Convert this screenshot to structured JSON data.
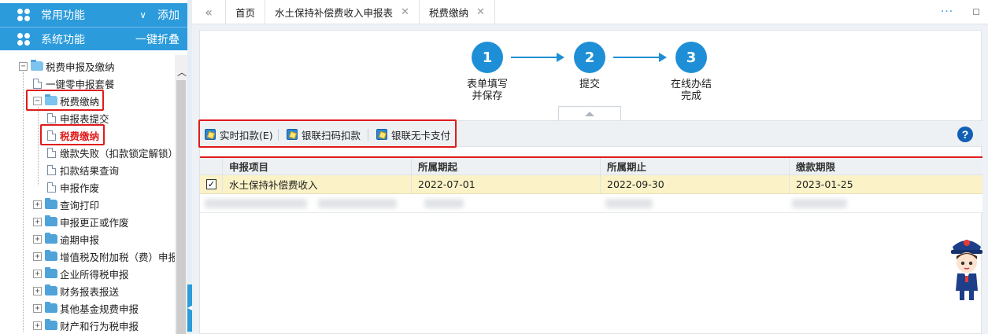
{
  "sidebar": {
    "menu1": {
      "title": "常用功能",
      "chevron": "∨",
      "action": "添加"
    },
    "menu2": {
      "title": "系统功能",
      "action": "一键折叠"
    },
    "tree": {
      "root": {
        "label": "税费申报及缴纳",
        "toggle": "−"
      },
      "items": [
        {
          "label": "一键零申报套餐"
        },
        {
          "label": "税费缴纳",
          "toggle": "−"
        },
        {
          "label": "申报表提交"
        },
        {
          "label": "税费缴纳"
        },
        {
          "label": "缴款失败（扣款锁定解锁）"
        },
        {
          "label": "扣款结果查询"
        },
        {
          "label": "申报作废"
        },
        {
          "label": "查询打印",
          "toggle": "+"
        },
        {
          "label": "申报更正或作废",
          "toggle": "+"
        },
        {
          "label": "逾期申报",
          "toggle": "+"
        },
        {
          "label": "增值税及附加税（费）申报",
          "toggle": "+"
        },
        {
          "label": "企业所得税申报",
          "toggle": "+"
        },
        {
          "label": "财务报表报送",
          "toggle": "+"
        },
        {
          "label": "其他基金规费申报",
          "toggle": "+"
        },
        {
          "label": "财产和行为税申报",
          "toggle": "+"
        }
      ]
    }
  },
  "tabs": {
    "nav_icon": "«",
    "items": [
      {
        "label": "首页"
      },
      {
        "label": "水土保持补偿费收入申报表",
        "close": "✕"
      },
      {
        "label": "税费缴纳",
        "close": "✕"
      }
    ],
    "more": "···"
  },
  "steps": [
    {
      "num": "1",
      "label": "表单填写\n并保存"
    },
    {
      "num": "2",
      "label": "提交"
    },
    {
      "num": "3",
      "label": "在线办结\n完成"
    }
  ],
  "toolbar": {
    "buttons": [
      {
        "label": "实时扣款(E)",
        "icon": "edit-icon"
      },
      {
        "label": "银联扫码扣款",
        "icon": "edit-icon"
      },
      {
        "label": "银联无卡支付",
        "icon": "edit-icon"
      }
    ],
    "help": "?"
  },
  "table": {
    "columns": [
      "申报项目",
      "所属期起",
      "所属期止",
      "缴款期限"
    ],
    "rows": [
      {
        "checked": "✓",
        "item": "水土保持补偿费收入",
        "start": "2022-07-01",
        "end": "2022-09-30",
        "deadline": "2023-01-25"
      }
    ]
  },
  "colors": {
    "accent": "#2b9bdc",
    "step": "#1e8fd6",
    "highlight": "#e01b1b",
    "selected_row": "#fbf3c7"
  }
}
